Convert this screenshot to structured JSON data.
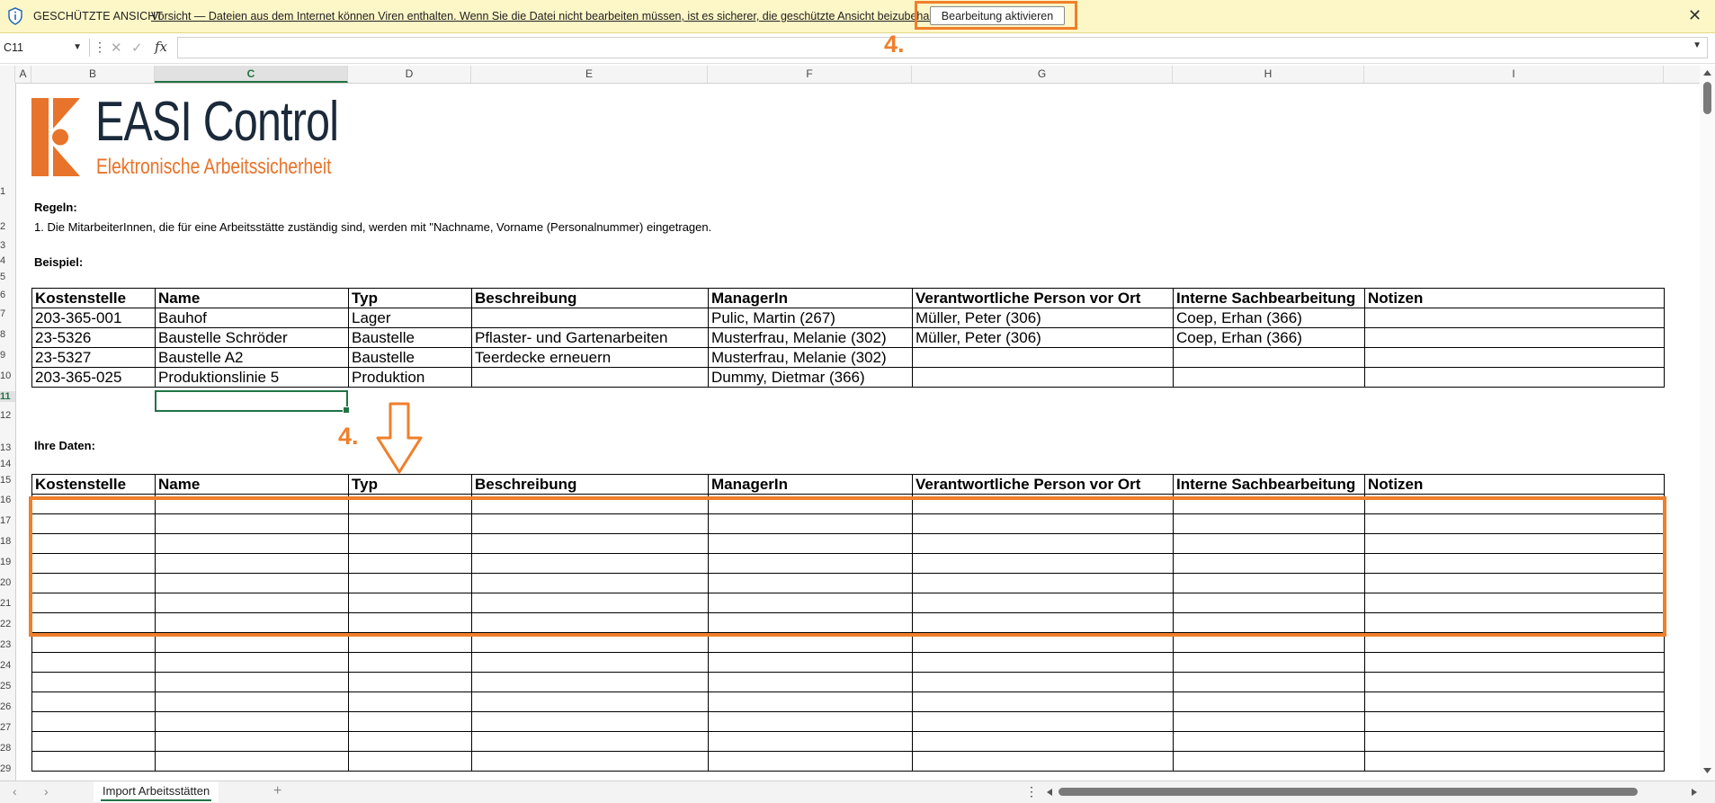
{
  "protected_view": {
    "title": "GESCHÜTZTE ANSICHT",
    "message": "Vorsicht — Dateien aus dem Internet können Viren enthalten. Wenn Sie die Datei nicht bearbeiten müssen, ist es sicherer, die geschützte Ansicht beizubehalten.",
    "button": "Bearbeitung aktivieren",
    "close": "✕"
  },
  "formula_bar": {
    "name_box": "C11",
    "formula": "",
    "fx": "fx"
  },
  "columns": [
    "A",
    "B",
    "C",
    "D",
    "E",
    "F",
    "G",
    "H",
    "I"
  ],
  "rows": [
    "1",
    "2",
    "3",
    "4",
    "5",
    "6",
    "7",
    "8",
    "9",
    "10",
    "11",
    "12",
    "13",
    "14",
    "15",
    "16",
    "17",
    "18",
    "19",
    "20",
    "21",
    "22",
    "23",
    "24",
    "25",
    "26",
    "27",
    "28",
    "29"
  ],
  "logo": {
    "main": "EASI Control",
    "sub": "Elektronische Arbeitssicherheit"
  },
  "rules": {
    "heading": "Regeln:",
    "line1": "1. Die MitarbeiterInnen, die für eine Arbeitsstätte zuständig sind, werden mit \"Nachname, Vorname (Personalnummer) eingetragen."
  },
  "example": {
    "heading": "Beispiel:",
    "headers": [
      "Kostenstelle",
      "Name",
      "Typ",
      "Beschreibung",
      "ManagerIn",
      "Verantwortliche Person vor Ort",
      "Interne Sachbearbeitung",
      "Notizen"
    ],
    "rows": [
      [
        "203-365-001",
        "Bauhof",
        "Lager",
        "",
        "Pulic, Martin (267)",
        "Müller, Peter (306)",
        "Coep, Erhan (366)",
        ""
      ],
      [
        "23-5326",
        "Baustelle Schröder",
        "Baustelle",
        "Pflaster- und Gartenarbeiten",
        "Musterfrau, Melanie (302)",
        "Müller, Peter (306)",
        "Coep, Erhan (366)",
        ""
      ],
      [
        "23-5327",
        "Baustelle A2",
        "Baustelle",
        "Teerdecke erneuern",
        "Musterfrau, Melanie (302)",
        "",
        "",
        ""
      ],
      [
        "203-365-025",
        "Produktionslinie 5",
        "Produktion",
        "",
        "Dummy, Dietmar (366)",
        "",
        "",
        ""
      ]
    ]
  },
  "your_data": {
    "heading": "Ihre Daten:",
    "headers": [
      "Kostenstelle",
      "Name",
      "Typ",
      "Beschreibung",
      "ManagerIn",
      "Verantwortliche Person vor Ort",
      "Interne Sachbearbeitung",
      "Notizen"
    ]
  },
  "annotations": {
    "step_top": "4.",
    "step_mid": "4."
  },
  "colors": {
    "accent_orange": "#f07f2b",
    "excel_green": "#217346",
    "banner_yellow": "#fdf6c6"
  },
  "sheet_tab": "Import Arbeitsstätten",
  "add_sheet": "+"
}
